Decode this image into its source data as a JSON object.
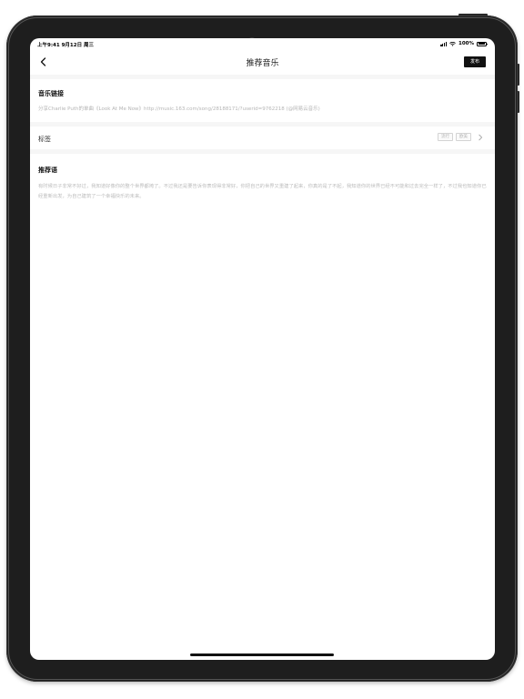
{
  "status_bar": {
    "time": "上午9:41  9月12日 周三",
    "battery": "100%"
  },
  "nav": {
    "title": "推荐音乐",
    "back_icon": "chevron-left-icon",
    "publish_label": "发布"
  },
  "music_link": {
    "title": "音乐链接",
    "value": "分享Charlie Puth的单曲《Look At Me Now》http://music.163.com/song/28188171/?userid=9762218 (@网易云音乐)"
  },
  "tags": {
    "label": "标签",
    "items": [
      "流行",
      "欧美"
    ],
    "chevron_icon": "chevron-right-icon"
  },
  "recommendation": {
    "title": "推荐语",
    "text": "有时候日子非常不好过，我知道好像你的整个世界都垮了。不过我还是要告诉你表现得非常好，你把自己的世界又重建了起来，你真的是了不起，我知道你的世界已经不可能和过去完全一样了，不过我也知道你已经重新出发，为自己建筑了一个幸福快乐的未来。"
  }
}
